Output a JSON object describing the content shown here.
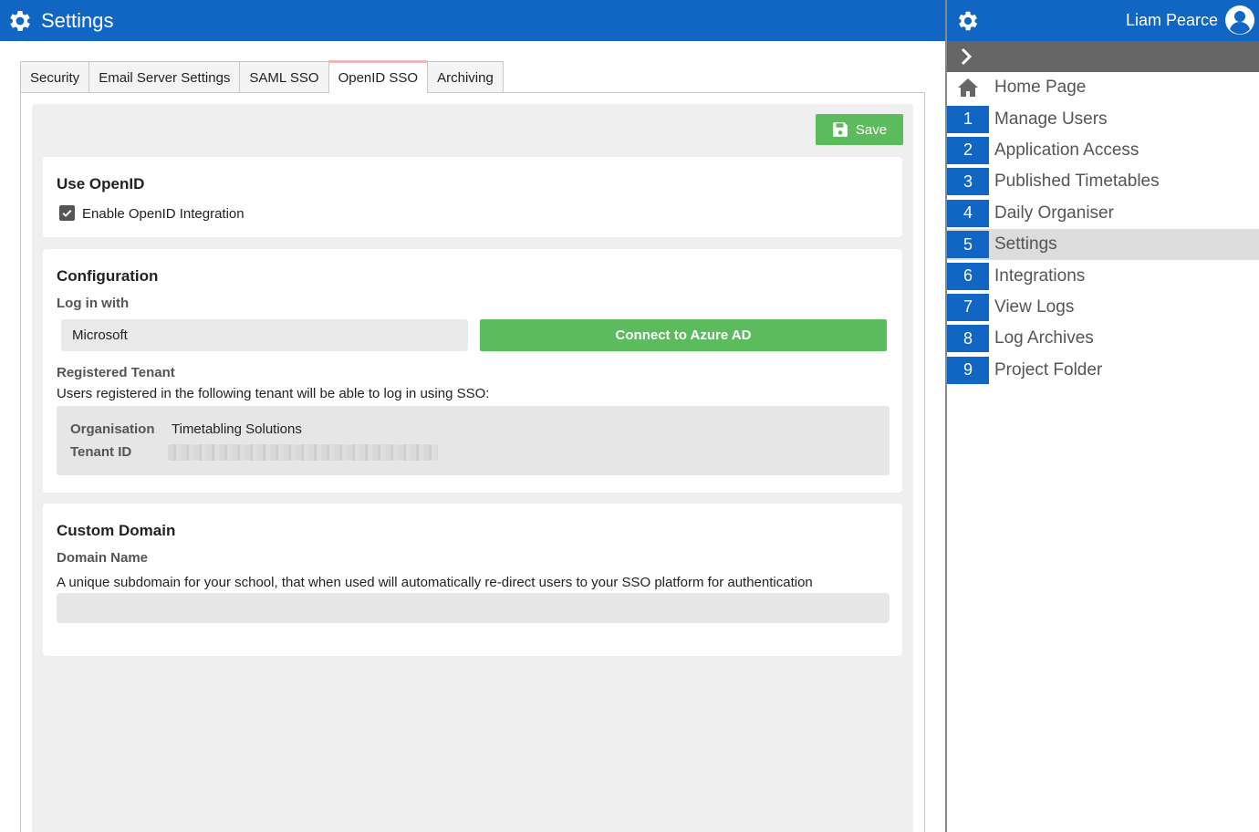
{
  "header": {
    "title": "Settings",
    "icon": "gear-icon"
  },
  "tabs": [
    {
      "label": "Security"
    },
    {
      "label": "Email Server Settings"
    },
    {
      "label": "SAML SSO"
    },
    {
      "label": "OpenID SSO",
      "active": true
    },
    {
      "label": "Archiving"
    }
  ],
  "toolbar": {
    "save_label": "Save"
  },
  "use_openid": {
    "title": "Use OpenID",
    "checkbox_label": "Enable OpenID Integration",
    "checked": true
  },
  "configuration": {
    "title": "Configuration",
    "login_with_label": "Log in with",
    "login_with_value": "Microsoft",
    "connect_label": "Connect to Azure AD",
    "registered_tenant_label": "Registered Tenant",
    "registered_tenant_desc": "Users registered in the following tenant will be able to log in using SSO:",
    "organisation_label": "Organisation",
    "organisation_value": "Timetabling Solutions",
    "tenant_id_label": "Tenant ID"
  },
  "custom_domain": {
    "title": "Custom Domain",
    "domain_name_label": "Domain Name",
    "description": "A unique subdomain for your school, that when used will automatically re-direct users to your SSO platform for authentication",
    "value": ""
  },
  "sidebar": {
    "user_name": "Liam Pearce",
    "items": [
      {
        "num": "",
        "label": "Home Page",
        "icon": "home-icon"
      },
      {
        "num": "1",
        "label": "Manage Users"
      },
      {
        "num": "2",
        "label": "Application Access"
      },
      {
        "num": "3",
        "label": "Published Timetables"
      },
      {
        "num": "4",
        "label": "Daily Organiser"
      },
      {
        "num": "5",
        "label": "Settings",
        "active": true
      },
      {
        "num": "6",
        "label": "Integrations"
      },
      {
        "num": "7",
        "label": "View Logs"
      },
      {
        "num": "8",
        "label": "Log Archives"
      },
      {
        "num": "9",
        "label": "Project Folder"
      }
    ]
  },
  "colors": {
    "brand": "#1166c4",
    "success": "#5cbb5c",
    "active_tab_accent": "#f3b5b5"
  }
}
